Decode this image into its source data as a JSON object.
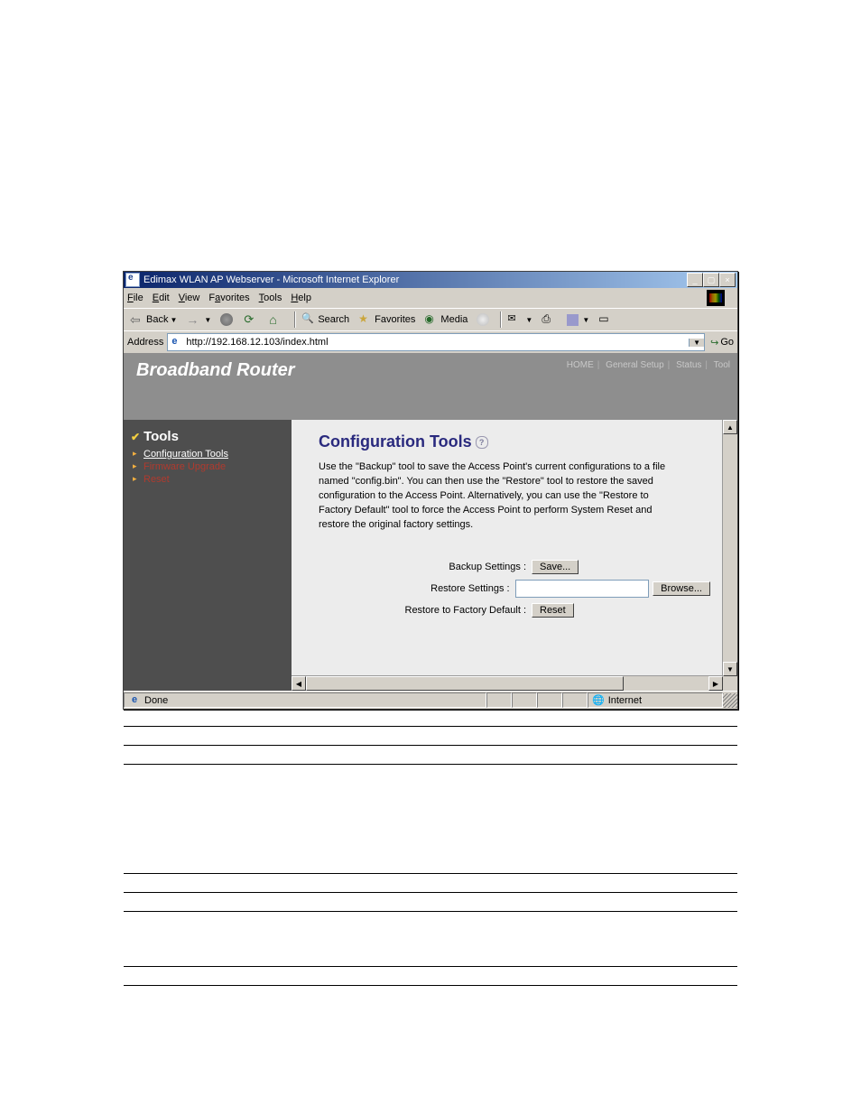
{
  "window": {
    "title": "Edimax WLAN AP Webserver - Microsoft Internet Explorer",
    "min": "_",
    "max": "▢",
    "close": "×"
  },
  "menubar": {
    "file": "File",
    "edit": "Edit",
    "view": "View",
    "favorites": "Favorites",
    "tools": "Tools",
    "help": "Help"
  },
  "toolbar": {
    "back": "Back",
    "search": "Search",
    "favorites": "Favorites",
    "media": "Media"
  },
  "addressbar": {
    "label": "Address",
    "url": "http://192.168.12.103/index.html",
    "go": "Go"
  },
  "banner": {
    "brand": "Broadband Router"
  },
  "topnav": {
    "home": "HOME",
    "general": "General Setup",
    "status": "Status",
    "tool": "Tool"
  },
  "sidebar": {
    "heading": "Tools",
    "items": [
      {
        "label": "Configuration Tools"
      },
      {
        "label": "Firmware Upgrade"
      },
      {
        "label": "Reset"
      }
    ]
  },
  "main": {
    "heading": "Configuration Tools",
    "description": "Use the \"Backup\" tool to save the Access Point's current configurations to a file named \"config.bin\". You can then use the \"Restore\" tool to restore the saved configuration to the Access Point. Alternatively, you can use the \"Restore to Factory Default\" tool to force the Access Point to perform System Reset and restore the original factory settings.",
    "backup_label": "Backup Settings :",
    "backup_btn": "Save...",
    "restore_label": "Restore Settings :",
    "restore_value": "",
    "browse_btn": "Browse...",
    "factory_label": "Restore to Factory Default :",
    "factory_btn": "Reset"
  },
  "statusbar": {
    "done": "Done",
    "zone": "Internet"
  }
}
